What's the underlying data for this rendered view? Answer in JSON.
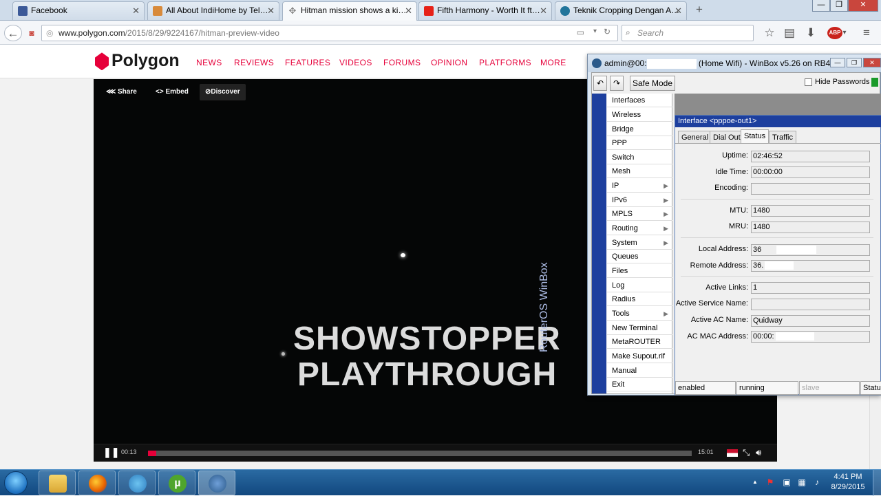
{
  "browser": {
    "tabs": [
      {
        "title": "Facebook",
        "favicon": "facebook-icon",
        "color": "#3b5998",
        "active": false
      },
      {
        "title": "All About IndiHome by Tel…",
        "favicon": "page-icon",
        "color": "#d88a3a",
        "active": false
      },
      {
        "title": "Hitman mission shows a ki…",
        "favicon": "loading-icon",
        "color": "#888888",
        "active": true
      },
      {
        "title": "Fifth Harmony - Worth It ft…",
        "favicon": "youtube-icon",
        "color": "#e62117",
        "active": false
      },
      {
        "title": "Teknik Cropping Dengan A…",
        "favicon": "wordpress-icon",
        "color": "#21759b",
        "active": false
      }
    ],
    "url_host": "www.polygon.com",
    "url_path": "/2015/8/29/9224167/hitman-preview-video",
    "search_placeholder": "Search",
    "adblock_label": "ABP"
  },
  "site": {
    "logo": "Polygon",
    "nav": [
      "NEWS",
      "REVIEWS",
      "FEATURES",
      "VIDEOS",
      "FORUMS",
      "OPINION",
      "PLATFORMS",
      "MORE"
    ],
    "accent": "#e6003a"
  },
  "video": {
    "share_label": "Share",
    "embed_label": "Embed",
    "discover_label": "Discover",
    "overlay_line1": "SHOWSTOPPER",
    "overlay_line2": "PLAYTHROUGH",
    "time_current": "00:13",
    "time_total": "15:01",
    "progress": 0.015
  },
  "winbox": {
    "title_prefix": "admin@00:",
    "title_suffix": "(Home Wifi) - WinBox v5.26 on RB4…",
    "safe_mode_label": "Safe Mode",
    "hide_passwords_label": "Hide Passwords",
    "brand_vertical": "RouterOS WinBox",
    "menu": [
      {
        "label": "Interfaces",
        "sub": false
      },
      {
        "label": "Wireless",
        "sub": false
      },
      {
        "label": "Bridge",
        "sub": false
      },
      {
        "label": "PPP",
        "sub": false
      },
      {
        "label": "Switch",
        "sub": false
      },
      {
        "label": "Mesh",
        "sub": false
      },
      {
        "label": "IP",
        "sub": true
      },
      {
        "label": "IPv6",
        "sub": true
      },
      {
        "label": "MPLS",
        "sub": true
      },
      {
        "label": "Routing",
        "sub": true
      },
      {
        "label": "System",
        "sub": true
      },
      {
        "label": "Queues",
        "sub": false
      },
      {
        "label": "Files",
        "sub": false
      },
      {
        "label": "Log",
        "sub": false
      },
      {
        "label": "Radius",
        "sub": false
      },
      {
        "label": "Tools",
        "sub": true
      },
      {
        "label": "New Terminal",
        "sub": false
      },
      {
        "label": "MetaROUTER",
        "sub": false
      },
      {
        "label": "Make Supout.rif",
        "sub": false
      },
      {
        "label": "Manual",
        "sub": false
      },
      {
        "label": "Exit",
        "sub": false
      }
    ],
    "interface_title": "Interface <pppoe-out1>",
    "tabs": [
      "General",
      "Dial Out",
      "Status",
      "Traffic"
    ],
    "active_tab": "Status",
    "fields": {
      "uptime_label": "Uptime:",
      "uptime": "02:46:52",
      "idle_label": "Idle Time:",
      "idle": "00:00:00",
      "encoding_label": "Encoding:",
      "encoding": "",
      "mtu_label": "MTU:",
      "mtu": "1480",
      "mru_label": "MRU:",
      "mru": "1480",
      "local_label": "Local Address:",
      "local": "36",
      "remote_label": "Remote Address:",
      "remote": "36.",
      "links_label": "Active Links:",
      "links": "1",
      "service_label": "Active Service Name:",
      "service": "",
      "ac_name_label": "Active AC Name:",
      "ac_name": "Quidway",
      "ac_mac_label": "AC MAC Address:",
      "ac_mac": "00:00:"
    },
    "status_bar": [
      "enabled",
      "running",
      "slave",
      "Status"
    ]
  },
  "taskbar": {
    "apps": [
      "explorer-icon",
      "firefox-icon",
      "network-icon",
      "utorrent-icon",
      "winbox-icon"
    ],
    "time": "4:41 PM",
    "date": "8/29/2015"
  }
}
